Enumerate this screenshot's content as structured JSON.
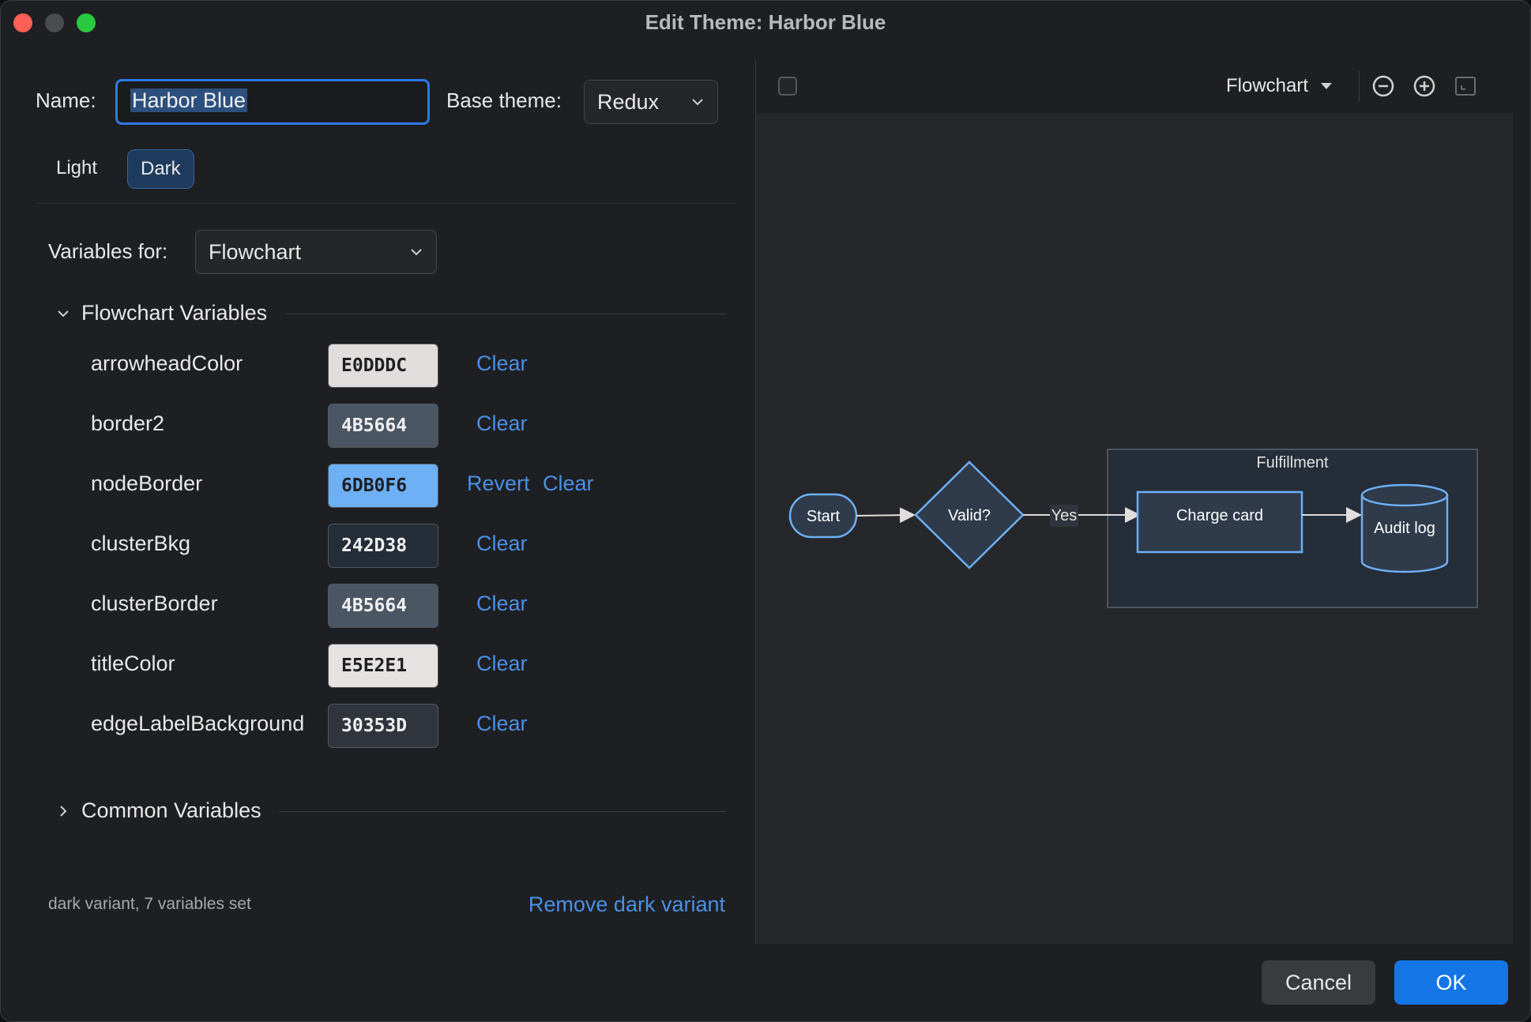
{
  "window": {
    "title": "Edit Theme: Harbor Blue"
  },
  "form": {
    "name_label": "Name:",
    "name_value": "Harbor Blue",
    "base_theme_label": "Base theme:",
    "base_theme_value": "Redux"
  },
  "mode_tabs": [
    {
      "label": "Light",
      "active": false
    },
    {
      "label": "Dark",
      "active": true
    }
  ],
  "variables_for": {
    "label": "Variables for:",
    "value": "Flowchart"
  },
  "sections": {
    "flowchart": {
      "title": "Flowchart Variables",
      "expanded": true
    },
    "common": {
      "title": "Common Variables",
      "expanded": false
    }
  },
  "variables": [
    {
      "name": "arrowheadColor",
      "value": "E0DDDC",
      "bg": "#e0dddc",
      "fg": "#1e1f22",
      "actions": [
        "Clear"
      ]
    },
    {
      "name": "border2",
      "value": "4B5664",
      "bg": "#4b5664",
      "fg": "#f0f0f0",
      "actions": [
        "Clear"
      ]
    },
    {
      "name": "nodeBorder",
      "value": "6DB0F6",
      "bg": "#6db0f6",
      "fg": "#1e1f22",
      "actions": [
        "Revert",
        "Clear"
      ]
    },
    {
      "name": "clusterBkg",
      "value": "242D38",
      "bg": "#242d38",
      "fg": "#f0f0f0",
      "actions": [
        "Clear"
      ]
    },
    {
      "name": "clusterBorder",
      "value": "4B5664",
      "bg": "#4b5664",
      "fg": "#f0f0f0",
      "actions": [
        "Clear"
      ]
    },
    {
      "name": "titleColor",
      "value": "E5E2E1",
      "bg": "#e5e2e1",
      "fg": "#1e1f22",
      "actions": [
        "Clear"
      ]
    },
    {
      "name": "edgeLabelBackground",
      "value": "30353D",
      "bg": "#30353d",
      "fg": "#f0f0f0",
      "actions": [
        "Clear"
      ]
    }
  ],
  "status": "dark variant, 7 variables set",
  "remove_link": "Remove dark variant",
  "preview": {
    "diagram_type": "Flowchart",
    "nodes": {
      "start": "Start",
      "decision": "Valid?",
      "edge_label": "Yes",
      "cluster_title": "Fulfillment",
      "charge": "Charge card",
      "audit": "Audit log"
    }
  },
  "buttons": {
    "cancel": "Cancel",
    "ok": "OK"
  },
  "colors": {
    "accent": "#1476e6",
    "link": "#4a90e6",
    "node_border": "#6db0f6"
  }
}
